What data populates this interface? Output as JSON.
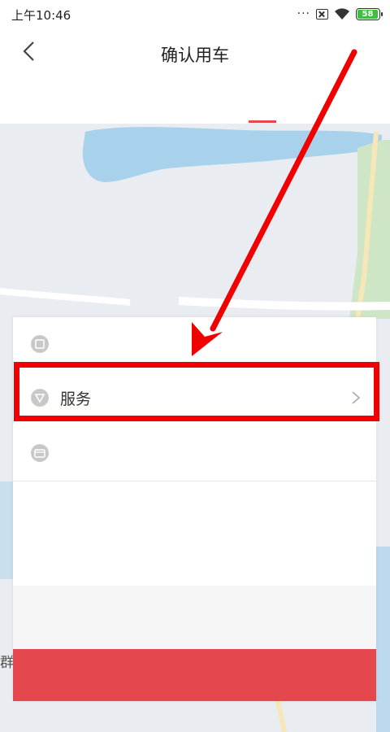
{
  "status_bar": {
    "time": "上午10:46",
    "signal_dots": "···",
    "battery_level": "58"
  },
  "nav": {
    "title": "确认用车",
    "back_icon": "chevron-left-icon"
  },
  "map": {
    "label_fragment": "群"
  },
  "sheet": {
    "rows": [
      {
        "icon": "box-icon",
        "label": ""
      },
      {
        "icon": "shield-icon",
        "label": "服务",
        "chevron": "chevron-right-icon"
      },
      {
        "icon": "wallet-icon",
        "label": ""
      }
    ],
    "confirm_button_label": ""
  },
  "colors": {
    "accent": "#e4474e",
    "annotation": "#f00000",
    "battery": "#3fbf3f"
  }
}
